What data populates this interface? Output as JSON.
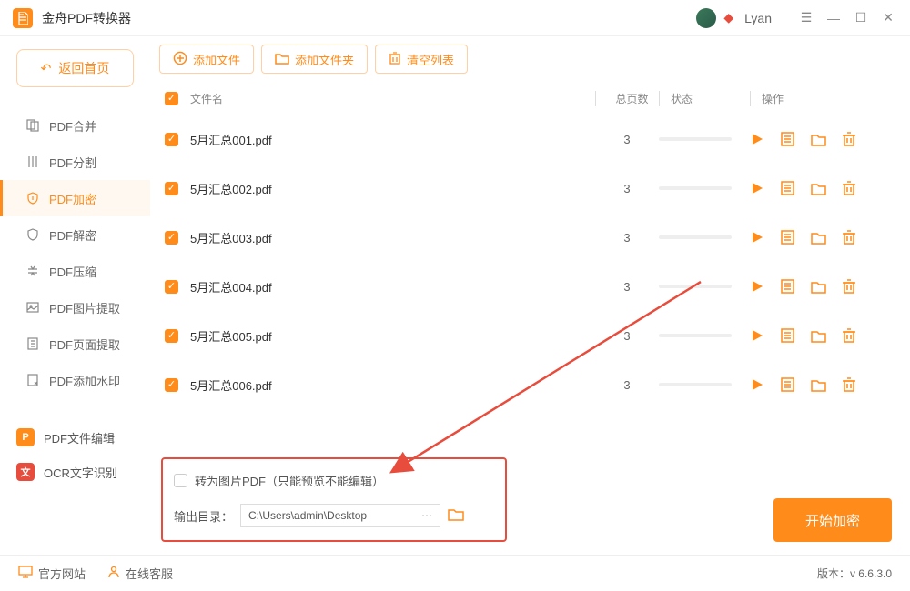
{
  "app": {
    "title": "金舟PDF转换器",
    "username": "Lyan"
  },
  "back_label": "返回首页",
  "sidebar": {
    "items": [
      {
        "label": "PDF合并"
      },
      {
        "label": "PDF分割"
      },
      {
        "label": "PDF加密"
      },
      {
        "label": "PDF解密"
      },
      {
        "label": "PDF压缩"
      },
      {
        "label": "PDF图片提取"
      },
      {
        "label": "PDF页面提取"
      },
      {
        "label": "PDF添加水印"
      }
    ],
    "bottom": [
      {
        "label": "PDF文件编辑"
      },
      {
        "label": "OCR文字识别"
      }
    ]
  },
  "toolbar": {
    "add_file": "添加文件",
    "add_folder": "添加文件夹",
    "clear_list": "清空列表"
  },
  "columns": {
    "name": "文件名",
    "pages": "总页数",
    "status": "状态",
    "ops": "操作"
  },
  "files": [
    {
      "name": "5月汇总001.pdf",
      "pages": "3"
    },
    {
      "name": "5月汇总002.pdf",
      "pages": "3"
    },
    {
      "name": "5月汇总003.pdf",
      "pages": "3"
    },
    {
      "name": "5月汇总004.pdf",
      "pages": "3"
    },
    {
      "name": "5月汇总005.pdf",
      "pages": "3"
    },
    {
      "name": "5月汇总006.pdf",
      "pages": "3"
    }
  ],
  "settings": {
    "to_image_label": "转为图片PDF（只能预览不能编辑）",
    "output_label": "输出目录：",
    "output_path": "C:\\Users\\admin\\Desktop"
  },
  "start_button": "开始加密",
  "status": {
    "website": "官方网站",
    "support": "在线客服",
    "version_label": "版本：",
    "version": "v 6.6.3.0"
  }
}
